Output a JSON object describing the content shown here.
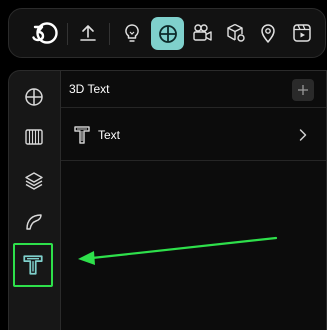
{
  "toolbar": {
    "items": [
      {
        "icon": "app-logo-icon"
      },
      {
        "icon": "upload-icon"
      },
      {
        "icon": "lightbulb-icon"
      },
      {
        "icon": "transform-target-icon",
        "active": true
      },
      {
        "icon": "video-camera-icon"
      },
      {
        "icon": "box-settings-icon"
      },
      {
        "icon": "location-pin-icon"
      },
      {
        "icon": "video-play-icon"
      }
    ]
  },
  "sidebar": {
    "items": [
      {
        "icon": "transform-target-icon"
      },
      {
        "icon": "film-strip-icon"
      },
      {
        "icon": "layers-icon"
      },
      {
        "icon": "curve-shape-icon"
      },
      {
        "icon": "3d-text-icon",
        "selected": true
      }
    ]
  },
  "panel": {
    "title": "3D Text",
    "add_icon": "plus-icon",
    "items": [
      {
        "label": "Text",
        "icon": "3d-text-icon",
        "chevron": "chevron-right-icon"
      }
    ]
  },
  "colors": {
    "accent": "#7fd0cc",
    "highlight": "#2ee04b",
    "background": "#000000",
    "panel": "#0c0c0c"
  }
}
